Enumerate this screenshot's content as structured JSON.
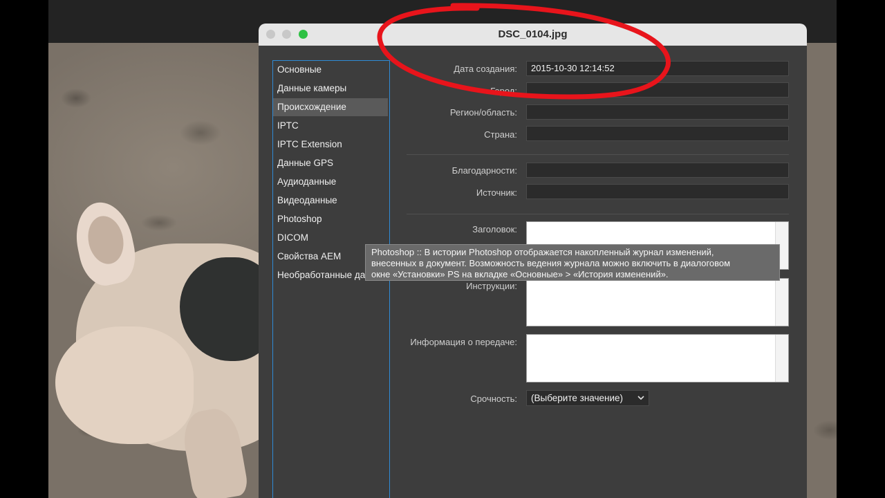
{
  "window": {
    "title": "DSC_0104.jpg",
    "accent": "#2f8bd6"
  },
  "sidebar": {
    "items": [
      {
        "label": "Основные"
      },
      {
        "label": "Данные камеры"
      },
      {
        "label": "Происхождение",
        "selected": true
      },
      {
        "label": "IPTC"
      },
      {
        "label": "IPTC Extension"
      },
      {
        "label": "Данные GPS"
      },
      {
        "label": "Аудиоданные"
      },
      {
        "label": "Видеоданные"
      },
      {
        "label": "Photoshop"
      },
      {
        "label": "DICOM"
      },
      {
        "label": "Свойства AEM"
      },
      {
        "label": "Необработанные да"
      }
    ]
  },
  "form": {
    "date_created": {
      "label": "Дата создания:",
      "value": "2015-10-30 12:14:52"
    },
    "city": {
      "label": "Город:",
      "value": ""
    },
    "region": {
      "label": "Регион/область:",
      "value": ""
    },
    "country": {
      "label": "Страна:",
      "value": ""
    },
    "credits": {
      "label": "Благодарности:",
      "value": ""
    },
    "source": {
      "label": "Источник:",
      "value": ""
    },
    "headline": {
      "label": "Заголовок:",
      "value": ""
    },
    "instructions": {
      "label": "Инструкции:",
      "value": ""
    },
    "transmission": {
      "label": "Информация о передаче:",
      "value": ""
    },
    "urgency": {
      "label": "Срочность:",
      "value": "(Выберите значение)"
    }
  },
  "tooltip": {
    "lines": [
      "Photoshop :: В истории Photoshop отображается накопленный журнал изменений,",
      "внесенных в документ. Возможность ведения журнала можно включить в диалоговом",
      "окне «Установки» PS на вкладке «Основные» > «История изменений»."
    ]
  },
  "annotation": {
    "color": "#e8141b"
  },
  "icons": [
    "close-traffic-light-icon",
    "minimize-traffic-light-icon",
    "zoom-traffic-light-icon",
    "chevron-down-icon"
  ]
}
